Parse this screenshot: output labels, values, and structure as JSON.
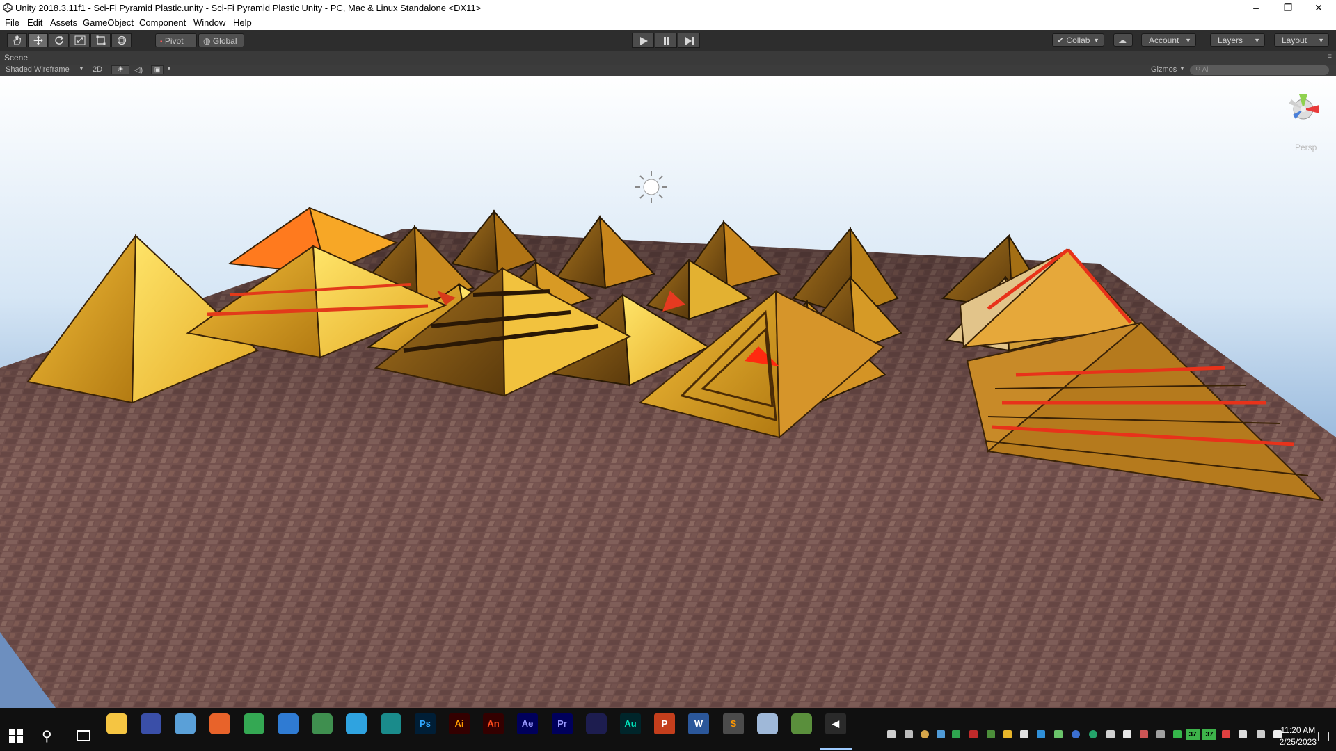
{
  "window": {
    "title": "Unity 2018.3.11f1 - Sci-Fi Pyramid Plastic.unity - Sci-Fi Pyramid Plastic Unity - PC, Mac & Linux Standalone <DX11>",
    "controls": {
      "minimize": "–",
      "maximize": "❐",
      "close": "✕"
    }
  },
  "menu": [
    "File",
    "Edit",
    "Assets",
    "GameObject",
    "Component",
    "Window",
    "Help"
  ],
  "toolbar": {
    "tools": [
      "hand-icon",
      "move-icon",
      "rotate-icon",
      "scale-icon",
      "rect-icon",
      "transform-icon"
    ],
    "active_tool": "move-icon",
    "pivot_label": "Pivot",
    "global_label": "Global",
    "collab_label": "Collab",
    "account_label": "Account",
    "layers_label": "Layers",
    "layout_label": "Layout"
  },
  "scene": {
    "tab_label": "Scene",
    "shading_mode": "Shaded Wireframe",
    "mode_2d": "2D",
    "gizmos_label": "Gizmos",
    "search_placeholder": "All",
    "persp_label": "Persp"
  },
  "taskbar": {
    "apps": [
      {
        "name": "file-explorer-icon",
        "label": "",
        "color": "#f5c542"
      },
      {
        "name": "vpn-icon",
        "label": "",
        "color": "#3a4fa8"
      },
      {
        "name": "paint-icon",
        "label": "",
        "color": "#5aa0d8"
      },
      {
        "name": "firefox-icon",
        "label": "",
        "color": "#e8632a"
      },
      {
        "name": "chrome-icon",
        "label": "",
        "color": "#34a853"
      },
      {
        "name": "magnifier-icon",
        "label": "",
        "color": "#2f7bd3"
      },
      {
        "name": "globe-icon",
        "label": "",
        "color": "#3f8f4f"
      },
      {
        "name": "earth-icon",
        "label": "",
        "color": "#2fa3e0"
      },
      {
        "name": "maya-icon",
        "label": "",
        "color": "#1a8b8b"
      },
      {
        "name": "photoshop-icon",
        "label": "Ps",
        "color": "#001e36",
        "text": "#31a8ff"
      },
      {
        "name": "illustrator-icon",
        "label": "Ai",
        "color": "#330000",
        "text": "#ff9a00"
      },
      {
        "name": "animate-icon",
        "label": "An",
        "color": "#330000",
        "text": "#ff4a1c"
      },
      {
        "name": "after-effects-icon",
        "label": "Ae",
        "color": "#00005b",
        "text": "#9999ff"
      },
      {
        "name": "premiere-icon",
        "label": "Pr",
        "color": "#00005b",
        "text": "#9999ff"
      },
      {
        "name": "media-encoder-icon",
        "label": "",
        "color": "#1d1d4f"
      },
      {
        "name": "audition-icon",
        "label": "Au",
        "color": "#00252a",
        "text": "#00e4bb"
      },
      {
        "name": "powerpoint-icon",
        "label": "P",
        "color": "#c43e1c",
        "text": "#ffffff"
      },
      {
        "name": "word-icon",
        "label": "W",
        "color": "#2b579a",
        "text": "#ffffff"
      },
      {
        "name": "sublime-icon",
        "label": "S",
        "color": "#4b4b4b",
        "text": "#ff9800"
      },
      {
        "name": "notepad-icon",
        "label": "",
        "color": "#9fb8d8"
      },
      {
        "name": "store-icon",
        "label": "",
        "color": "#5a8f3c"
      },
      {
        "name": "unity-icon",
        "label": "◀",
        "color": "#2a2a2a",
        "text": "#ffffff"
      }
    ],
    "time": "11:20 AM",
    "date": "2/25/2023",
    "tray_numbers": [
      "37",
      "37"
    ]
  }
}
